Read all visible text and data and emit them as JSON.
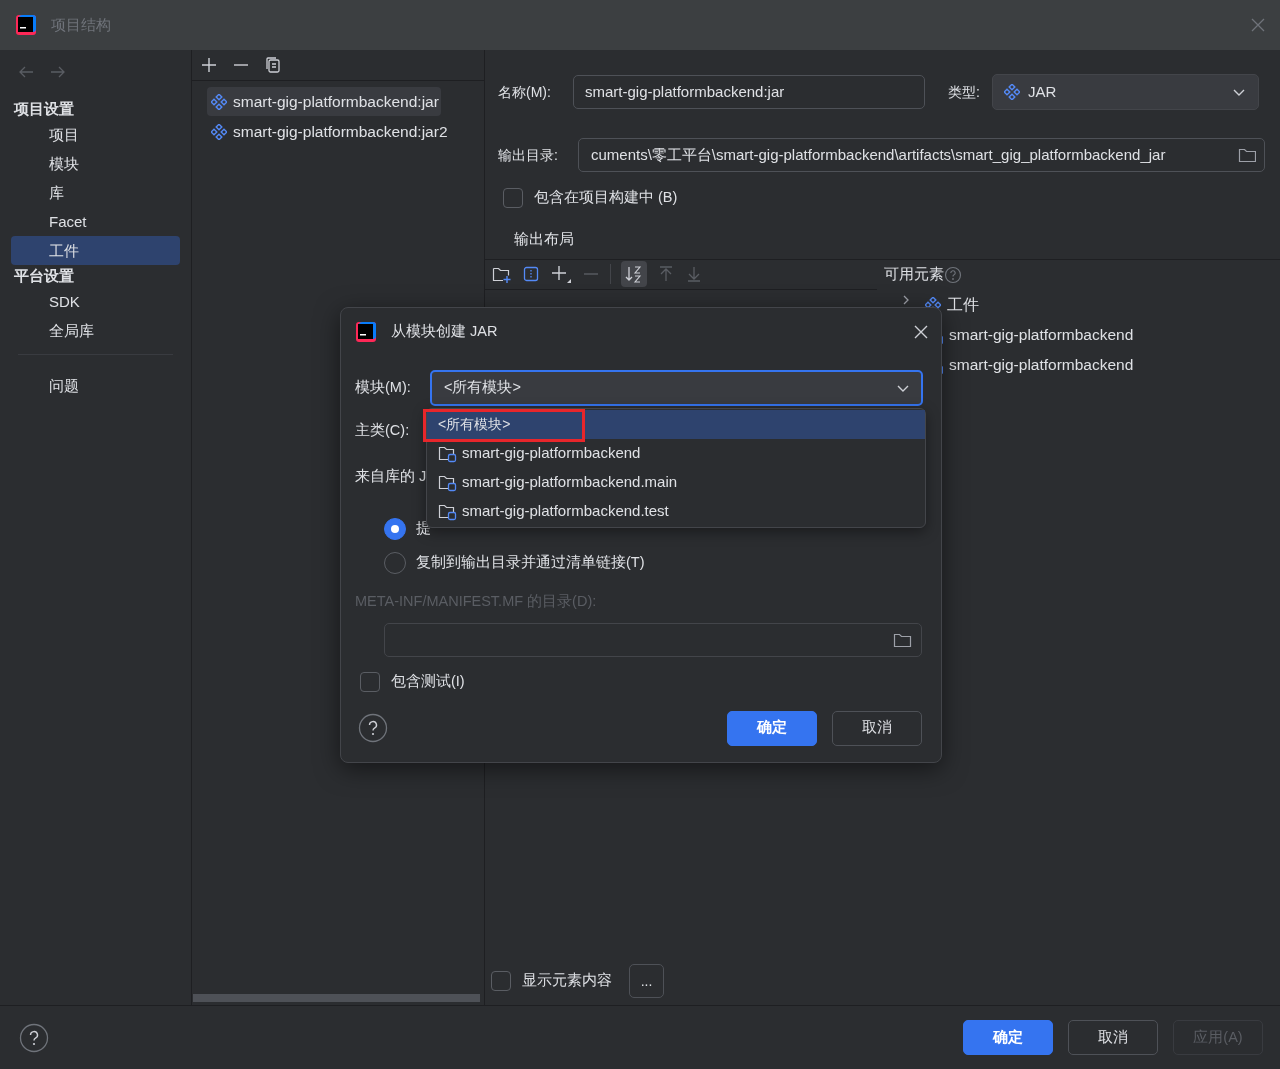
{
  "window": {
    "title": "项目结构"
  },
  "sidebar": {
    "sections": [
      {
        "heading": "项目设置",
        "items": [
          {
            "label": "项目",
            "selected": false
          },
          {
            "label": "模块",
            "selected": false
          },
          {
            "label": "库",
            "selected": false
          },
          {
            "label": "Facet",
            "selected": false
          },
          {
            "label": "工件",
            "selected": true
          }
        ]
      },
      {
        "heading": "平台设置",
        "items": [
          {
            "label": "SDK",
            "selected": false
          },
          {
            "label": "全局库",
            "selected": false
          }
        ]
      }
    ],
    "problems": {
      "label": "问题",
      "selected": false
    }
  },
  "artifacts": [
    {
      "label": "smart-gig-platformbackend:jar",
      "selected": true
    },
    {
      "label": "smart-gig-platformbackend:jar2",
      "selected": false
    }
  ],
  "form": {
    "name_label": "名称(M):",
    "name_value": "smart-gig-platformbackend:jar",
    "type_label": "类型:",
    "type_value": "JAR",
    "output_label": "输出目录:",
    "output_value": "cuments\\零工平台\\smart-gig-platformbackend\\artifacts\\smart_gig_platformbackend_jar",
    "include_in_build": {
      "label": "包含在项目构建中 (B)",
      "checked": false
    }
  },
  "layout": {
    "title": "输出布局",
    "available_title": "可用元素",
    "available": [
      {
        "label": "工件",
        "kind": "artifact",
        "expanded": false
      },
      {
        "label": "smart-gig-platformbackend",
        "kind": "module"
      },
      {
        "label": "smart-gig-platformbackend",
        "kind": "module"
      }
    ],
    "show_content": {
      "label": "显示元素内容",
      "checked": false
    },
    "more_button": "..."
  },
  "footer": {
    "buttons": [
      {
        "label": "确定",
        "kind": "primary"
      },
      {
        "label": "取消",
        "kind": "normal"
      },
      {
        "label": "应用(A)",
        "kind": "disabled"
      }
    ]
  },
  "dialog": {
    "title": "从模块创建 JAR",
    "module_label": "模块(M):",
    "module_value": "<所有模块>",
    "options": [
      {
        "label": "<所有模块>",
        "kind": "all",
        "selected": true,
        "highlighted": true
      },
      {
        "label": "smart-gig-platformbackend",
        "kind": "module",
        "selected": false,
        "highlighted": false
      },
      {
        "label": "smart-gig-platformbackend.main",
        "kind": "module",
        "selected": false,
        "highlighted": false
      },
      {
        "label": "smart-gig-platformbackend.test",
        "kind": "module",
        "selected": false,
        "highlighted": false
      }
    ],
    "main_class_label": "主类(C):",
    "libs_label": "来自库的 J",
    "radios": [
      {
        "label": "提",
        "selected": true
      },
      {
        "label": "复制到输出目录并通过清单链接(T)",
        "selected": false
      }
    ],
    "manifest_label": "META-INF/MANIFEST.MF 的目录(D):",
    "include_tests": {
      "label": "包含测试(I)",
      "checked": false
    },
    "buttons": [
      {
        "label": "确定",
        "kind": "primary"
      },
      {
        "label": "取消",
        "kind": "normal"
      }
    ]
  }
}
